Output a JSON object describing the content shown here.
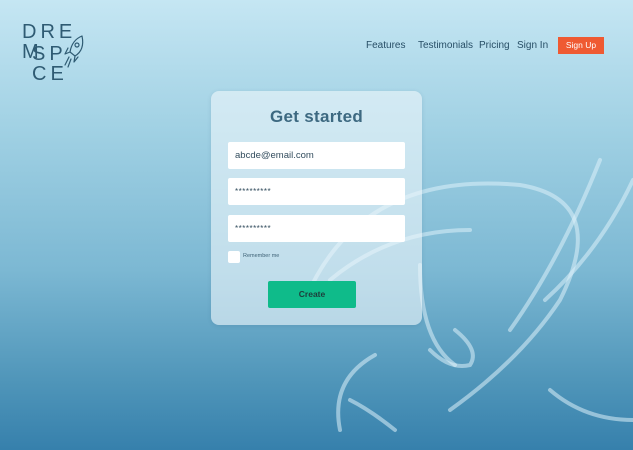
{
  "brand": {
    "line1": "DRE M",
    "line2": "SP CE",
    "logo_icon": "rocket-icon"
  },
  "nav": {
    "items": [
      {
        "label": "Features"
      },
      {
        "label": "Testimonials"
      },
      {
        "label": "Pricing"
      },
      {
        "label": "Sign In"
      }
    ],
    "signup_label": "Sign Up"
  },
  "form": {
    "title": "Get started",
    "email_value": "abcde@email.com",
    "password_value": "**********",
    "confirm_password_value": "**********",
    "remember_label": "Remember me",
    "remember_checked": false,
    "submit_label": "Create"
  },
  "colors": {
    "accent": "#ef5a32",
    "submit": "#0fbb8a",
    "title": "#3d6981",
    "background_top": "#c5e6f3",
    "background_bottom": "#3680ac"
  }
}
